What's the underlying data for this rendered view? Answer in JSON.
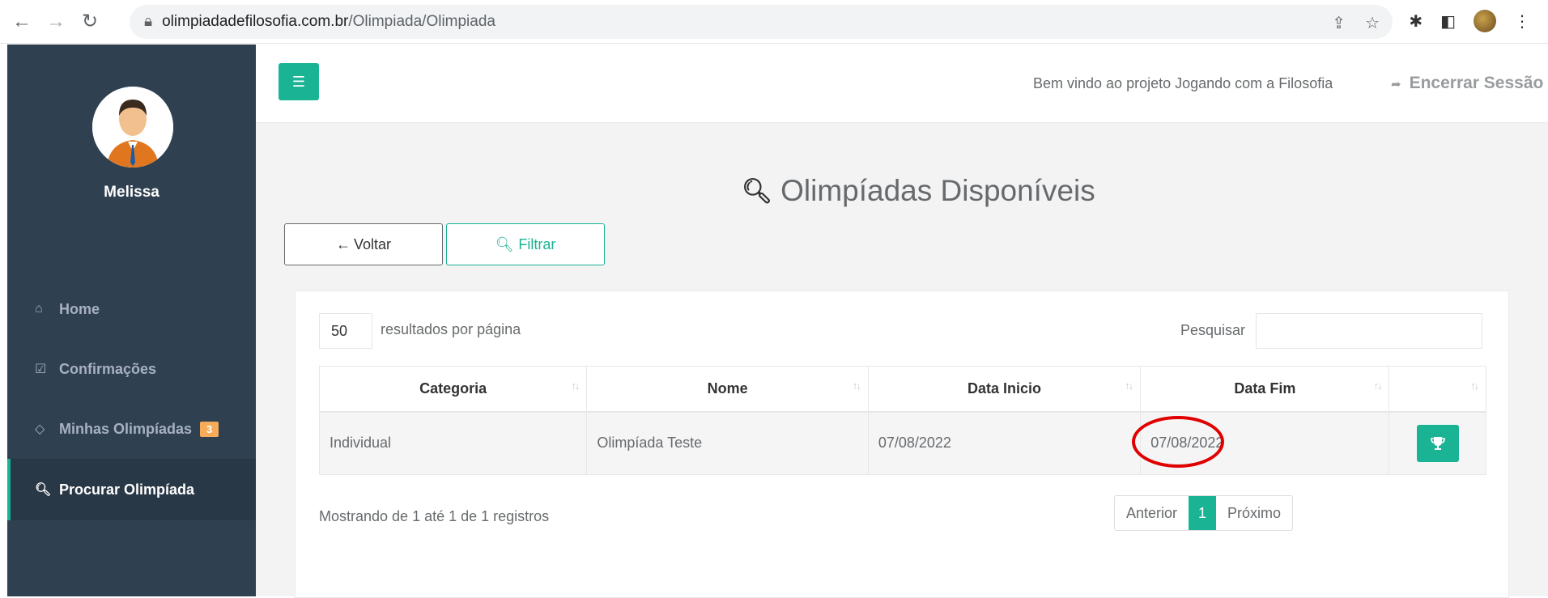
{
  "browser": {
    "url_host": "olimpiadadefilosofia.com.br",
    "url_path": "/Olimpiada/Olimpiada"
  },
  "sidebar": {
    "user_name": "Melissa",
    "items": [
      {
        "label": "Home",
        "icon": "home-icon"
      },
      {
        "label": "Confirmações",
        "icon": "check-square-icon"
      },
      {
        "label": "Minhas Olimpíadas",
        "icon": "diamond-icon",
        "badge": "3"
      },
      {
        "label": "Procurar Olimpíada",
        "icon": "search-icon",
        "active": true
      }
    ]
  },
  "topbar": {
    "welcome": "Bem vindo ao projeto Jogando com a Filosofia",
    "logout": "Encerrar Sessão"
  },
  "main": {
    "title": "Olimpíadas Disponíveis",
    "back_label": "Voltar",
    "filter_label": "Filtrar",
    "length_value": "50",
    "length_label": "resultados por página",
    "search_label": "Pesquisar",
    "table": {
      "headers": [
        "Categoria",
        "Nome",
        "Data Inicio",
        "Data Fim",
        ""
      ],
      "rows": [
        {
          "categoria": "Individual",
          "nome": "Olimpíada Teste",
          "data_inicio": "07/08/2022",
          "data_fim": "07/08/2022"
        }
      ]
    },
    "info": "Mostrando de 1 até 1 de 1 registros",
    "pager": {
      "prev": "Anterior",
      "current": "1",
      "next": "Próximo"
    }
  },
  "colors": {
    "accent": "#1ab394",
    "sidebar": "#2f4050",
    "badge": "#f8ac59",
    "highlight": "#e00000"
  }
}
